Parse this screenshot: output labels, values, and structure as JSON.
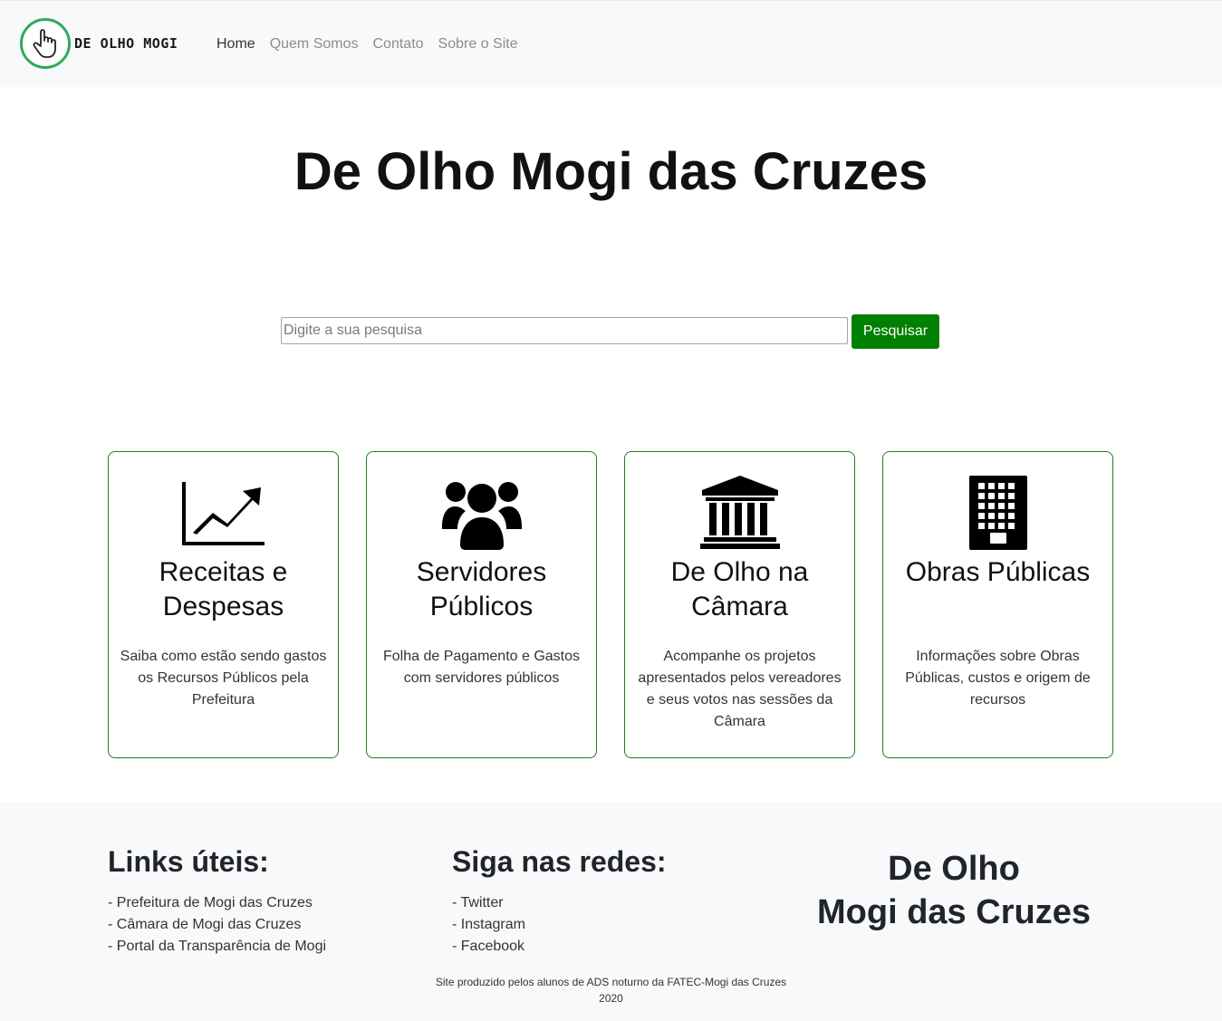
{
  "brand": {
    "name": "DE OLHO MOGI",
    "accent_color": "#2eaa5c"
  },
  "nav": {
    "items": [
      {
        "label": "Home",
        "active": true
      },
      {
        "label": "Quem Somos",
        "active": false
      },
      {
        "label": "Contato",
        "active": false
      },
      {
        "label": "Sobre o Site",
        "active": false
      }
    ]
  },
  "hero": {
    "title": "De Olho Mogi das Cruzes"
  },
  "search": {
    "placeholder": "Digite a sua pesquisa",
    "value": "",
    "button_label": "Pesquisar",
    "button_color": "#008000"
  },
  "cards": [
    {
      "icon": "chart-line-icon",
      "title": "Receitas e Despesas",
      "text": "Saiba como estão sendo gastos os Recursos Públicos pela Prefeitura"
    },
    {
      "icon": "users-icon",
      "title": "Servidores Públicos",
      "text": "Folha de Pagamento e Gastos com servidores públicos"
    },
    {
      "icon": "landmark-icon",
      "title": "De Olho na Câmara",
      "text": "Acompanhe os projetos apresentados pelos vereadores e seus votos nas sessões da Câmara"
    },
    {
      "icon": "building-icon",
      "title": "Obras Públicas",
      "text": "Informações sobre Obras Públicas, custos e origem de recursos"
    }
  ],
  "footer": {
    "links_title": "Links úteis:",
    "links": [
      "- Prefeitura de Mogi das Cruzes",
      "- Câmara de Mogi das Cruzes",
      "- Portal da Transparência de Mogi"
    ],
    "social_title": "Siga nas redes:",
    "social": [
      "- Twitter",
      "- Instagram",
      "- Facebook"
    ],
    "brand_line1": "De Olho",
    "brand_line2": "Mogi das Cruzes",
    "credit_line1": "Site produzido pelos alunos de ADS noturno da FATEC-Mogi das Cruzes",
    "credit_line2": "2020"
  }
}
